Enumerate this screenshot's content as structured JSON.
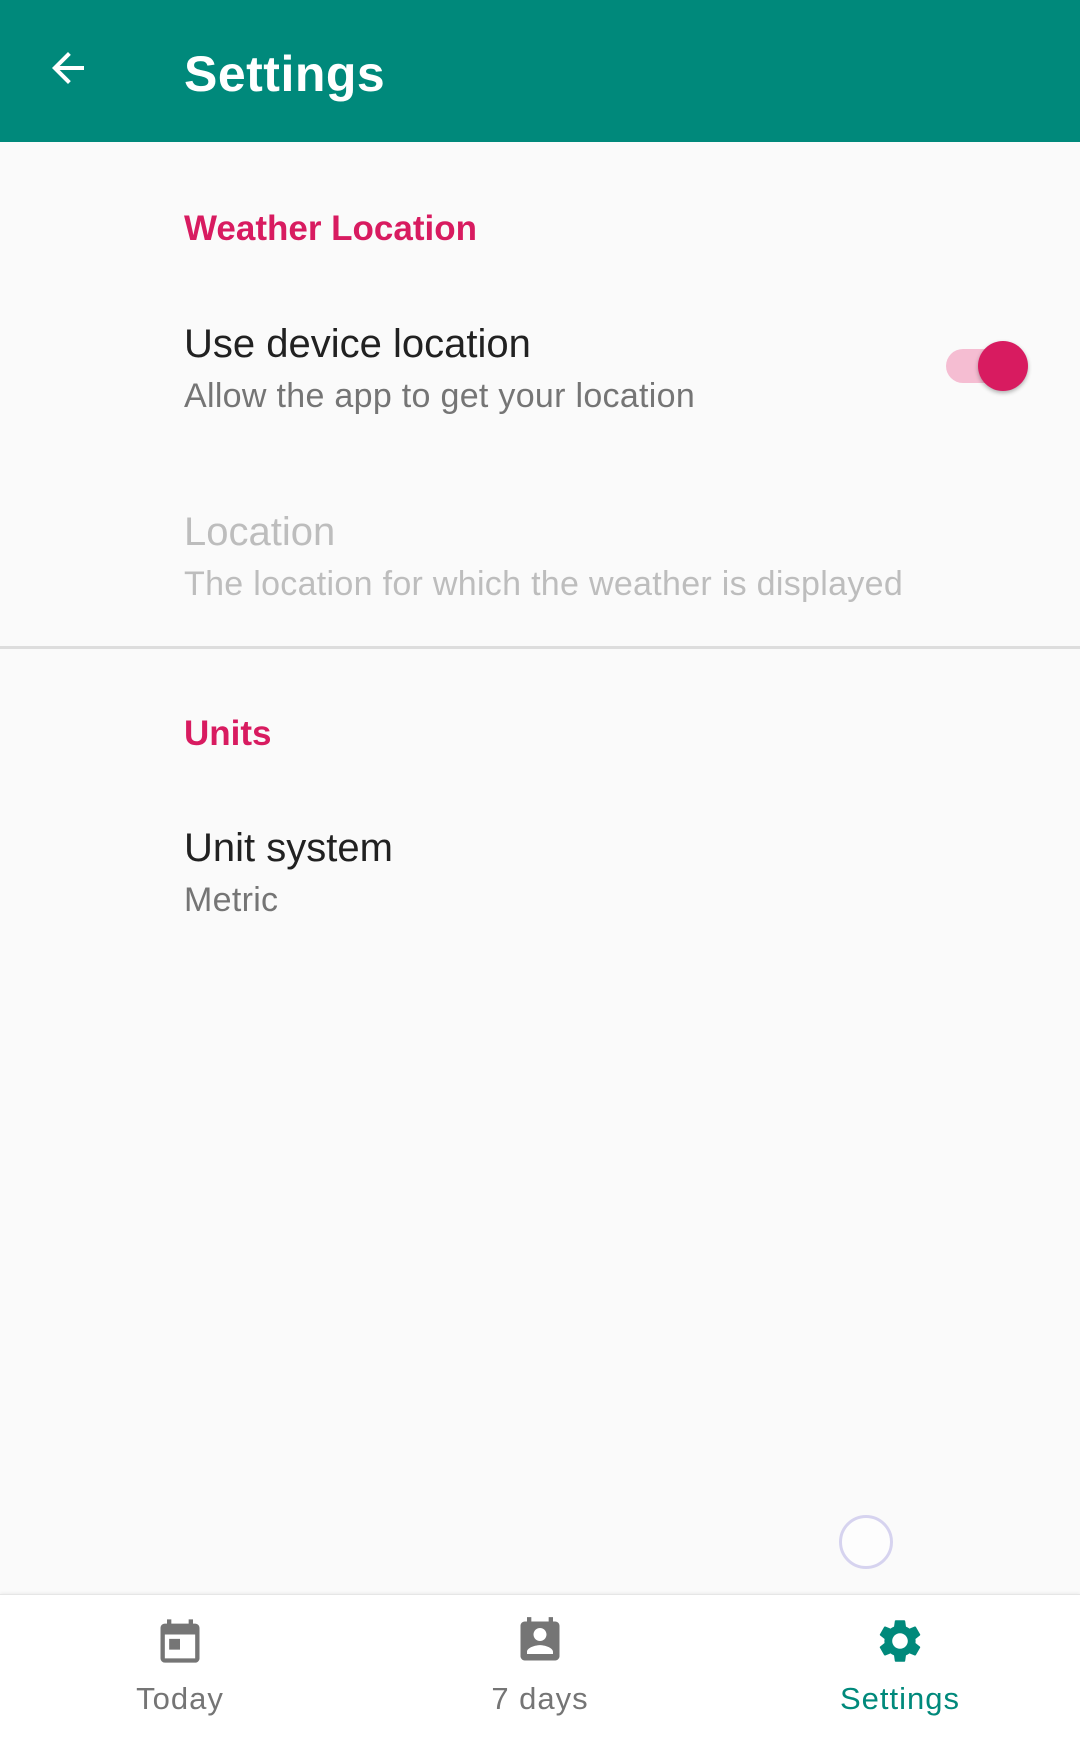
{
  "app_bar": {
    "title": "Settings",
    "back_icon": "arrow-back-icon"
  },
  "colors": {
    "app_bar": "#00897b",
    "accent": "#d81b60",
    "nav_active": "#00897b",
    "nav_inactive": "#757575"
  },
  "sections": [
    {
      "title": "Weather Location",
      "preferences": [
        {
          "title": "Use device location",
          "summary": "Allow the app to get your location",
          "switch": true
        },
        {
          "title": "Location",
          "summary": "The location for which the weather is displayed",
          "enabled": false
        }
      ]
    },
    {
      "title": "Units",
      "preferences": [
        {
          "title": "Unit system",
          "summary": "Metric"
        }
      ]
    }
  ],
  "bottom_nav": {
    "items": [
      {
        "label": "Today",
        "icon": "calendar-icon",
        "active": false
      },
      {
        "label": "7 days",
        "icon": "contact-calendar-icon",
        "active": false
      },
      {
        "label": "Settings",
        "icon": "gear-icon",
        "active": true
      }
    ]
  }
}
